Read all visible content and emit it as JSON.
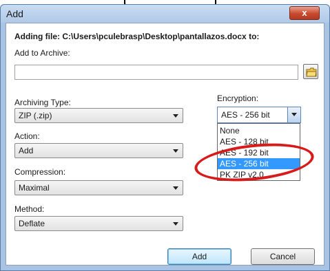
{
  "window": {
    "title": "Add",
    "close_symbol": "x"
  },
  "header": {
    "adding_file_text": "Adding file: C:\\Users\\pculebrasp\\Desktop\\pantallazos.docx to:"
  },
  "archive": {
    "label": "Add to Archive:",
    "value": ""
  },
  "archiving_type": {
    "label": "Archiving Type:",
    "value": "ZIP (.zip)"
  },
  "action": {
    "label": "Action:",
    "value": "Add"
  },
  "compression": {
    "label": "Compression:",
    "value": "Maximal"
  },
  "method": {
    "label": "Method:",
    "value": "Deflate"
  },
  "encryption": {
    "label": "Encryption:",
    "value": "AES - 256 bit",
    "options": [
      "None",
      "AES - 128 bit",
      "AES - 192 bit",
      "AES - 256 bit",
      "PK ZIP v2.0"
    ],
    "highlighted_option": "AES - 256 bit"
  },
  "buttons": {
    "add": "Add",
    "cancel": "Cancel"
  },
  "icons": {
    "browse": "folder-icon",
    "close": "close-icon"
  },
  "colors": {
    "selection": "#3399ff",
    "annotation": "#d91a1a",
    "close": "#c84a2f"
  }
}
